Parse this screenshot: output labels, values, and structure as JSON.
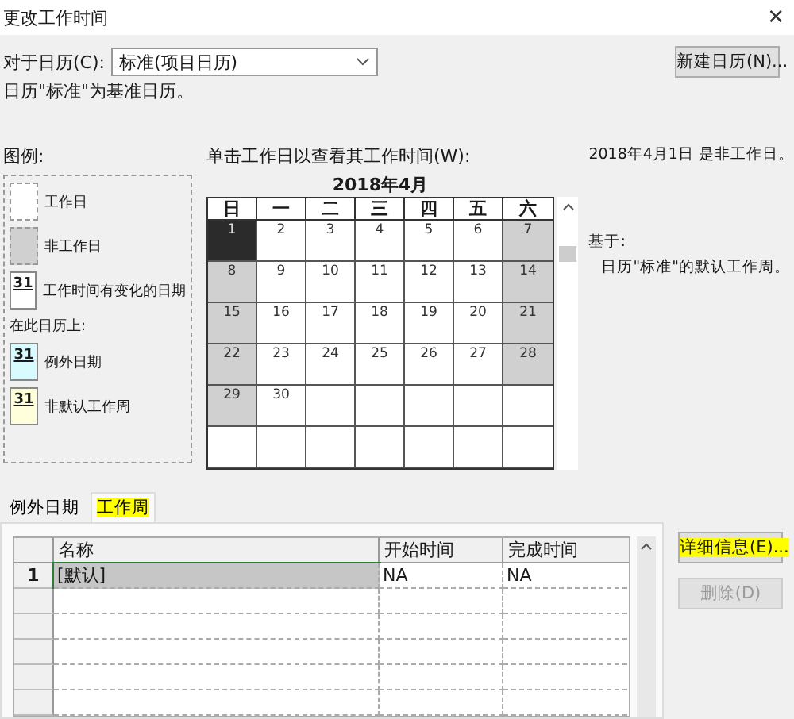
{
  "window": {
    "title": "更改工作时间",
    "close": "✕"
  },
  "calendar_field": {
    "label": "对于日历(C):",
    "value": "标准(项目日历)"
  },
  "new_calendar_button": {
    "label": "新建日历(N)..."
  },
  "base_note": "日历\"标准\"为基准日历。",
  "legend": {
    "title": "图例:",
    "items": [
      {
        "kind": "working",
        "label": "工作日"
      },
      {
        "kind": "nonworking",
        "label": "非工作日"
      },
      {
        "kind": "changed",
        "label": "工作时间有变化的日期",
        "sample": "31"
      }
    ],
    "section_label": "在此日历上:",
    "section_items": [
      {
        "kind": "exception",
        "label": "例外日期",
        "sample": "31"
      },
      {
        "kind": "nondefault",
        "label": "非默认工作周",
        "sample": "31"
      }
    ]
  },
  "calendar": {
    "prompt": "单击工作日以查看其工作时间(W):",
    "month": "2018年4月",
    "weekdays": [
      "日",
      "一",
      "二",
      "三",
      "四",
      "五",
      "六"
    ],
    "weeks": [
      [
        {
          "day": "1",
          "kind": "off",
          "selected": true
        },
        {
          "day": "2",
          "kind": "work",
          "selected": false
        },
        {
          "day": "3",
          "kind": "work",
          "selected": false
        },
        {
          "day": "4",
          "kind": "work",
          "selected": false
        },
        {
          "day": "5",
          "kind": "work",
          "selected": false
        },
        {
          "day": "6",
          "kind": "work",
          "selected": false
        },
        {
          "day": "7",
          "kind": "off",
          "selected": false
        }
      ],
      [
        {
          "day": "8",
          "kind": "off",
          "selected": false
        },
        {
          "day": "9",
          "kind": "work",
          "selected": false
        },
        {
          "day": "10",
          "kind": "work",
          "selected": false
        },
        {
          "day": "11",
          "kind": "work",
          "selected": false
        },
        {
          "day": "12",
          "kind": "work",
          "selected": false
        },
        {
          "day": "13",
          "kind": "work",
          "selected": false
        },
        {
          "day": "14",
          "kind": "off",
          "selected": false
        }
      ],
      [
        {
          "day": "15",
          "kind": "off",
          "selected": false
        },
        {
          "day": "16",
          "kind": "work",
          "selected": false
        },
        {
          "day": "17",
          "kind": "work",
          "selected": false
        },
        {
          "day": "18",
          "kind": "work",
          "selected": false
        },
        {
          "day": "19",
          "kind": "work",
          "selected": false
        },
        {
          "day": "20",
          "kind": "work",
          "selected": false
        },
        {
          "day": "21",
          "kind": "off",
          "selected": false
        }
      ],
      [
        {
          "day": "22",
          "kind": "off",
          "selected": false
        },
        {
          "day": "23",
          "kind": "work",
          "selected": false
        },
        {
          "day": "24",
          "kind": "work",
          "selected": false
        },
        {
          "day": "25",
          "kind": "work",
          "selected": false
        },
        {
          "day": "26",
          "kind": "work",
          "selected": false
        },
        {
          "day": "27",
          "kind": "work",
          "selected": false
        },
        {
          "day": "28",
          "kind": "off",
          "selected": false
        }
      ],
      [
        {
          "day": "29",
          "kind": "off",
          "selected": false
        },
        {
          "day": "30",
          "kind": "work",
          "selected": false
        },
        {
          "kind": "blank"
        },
        {
          "kind": "blank"
        },
        {
          "kind": "blank"
        },
        {
          "kind": "blank"
        },
        {
          "kind": "blank"
        }
      ],
      [
        {
          "kind": "blank"
        },
        {
          "kind": "blank"
        },
        {
          "kind": "blank"
        },
        {
          "kind": "blank"
        },
        {
          "kind": "blank"
        },
        {
          "kind": "blank"
        },
        {
          "kind": "blank"
        }
      ]
    ]
  },
  "info": {
    "status": "2018年4月1日 是非工作日。",
    "based_on_label": "基于:",
    "based_on_text": "日历\"标准\"的默认工作周。"
  },
  "tabs": [
    {
      "label": "例外日期",
      "selected": false,
      "highlighted": false
    },
    {
      "label": "工作周",
      "selected": true,
      "highlighted": true
    }
  ],
  "table": {
    "columns": [
      "名称",
      "开始时间",
      "完成时间"
    ],
    "rows": [
      {
        "number": "1",
        "name": "[默认]",
        "start": "NA",
        "finish": "NA",
        "selected": true
      }
    ]
  },
  "side_buttons": [
    {
      "label": "详细信息(E)...",
      "disabled": false,
      "highlighted": true
    },
    {
      "label": "删除(D)",
      "disabled": true,
      "highlighted": false
    }
  ]
}
